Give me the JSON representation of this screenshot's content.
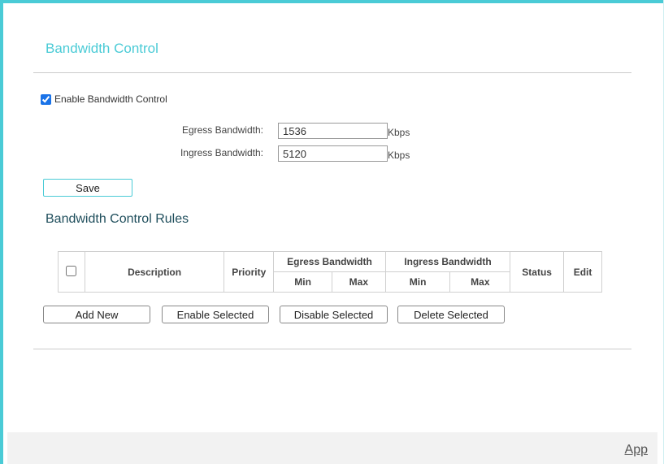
{
  "page": {
    "title": "Bandwidth Control",
    "accent_color": "#4acbd6"
  },
  "settings": {
    "enable_label": "Enable Bandwidth Control",
    "enable_checked": true,
    "egress_label": "Egress Bandwidth:",
    "egress_value": "1536",
    "egress_unit": "Kbps",
    "ingress_label": "Ingress Bandwidth:",
    "ingress_value": "5120",
    "ingress_unit": "Kbps",
    "save_label": "Save"
  },
  "rules": {
    "title": "Bandwidth Control Rules",
    "columns": {
      "description": "Description",
      "priority": "Priority",
      "egress": "Egress Bandwidth",
      "ingress": "Ingress Bandwidth",
      "min": "Min",
      "max": "Max",
      "status": "Status",
      "edit": "Edit"
    },
    "buttons": {
      "add_new": "Add New",
      "enable_selected": "Enable Selected",
      "disable_selected": "Disable Selected",
      "delete_selected": "Delete Selected"
    }
  },
  "footer": {
    "link_label": "App"
  }
}
